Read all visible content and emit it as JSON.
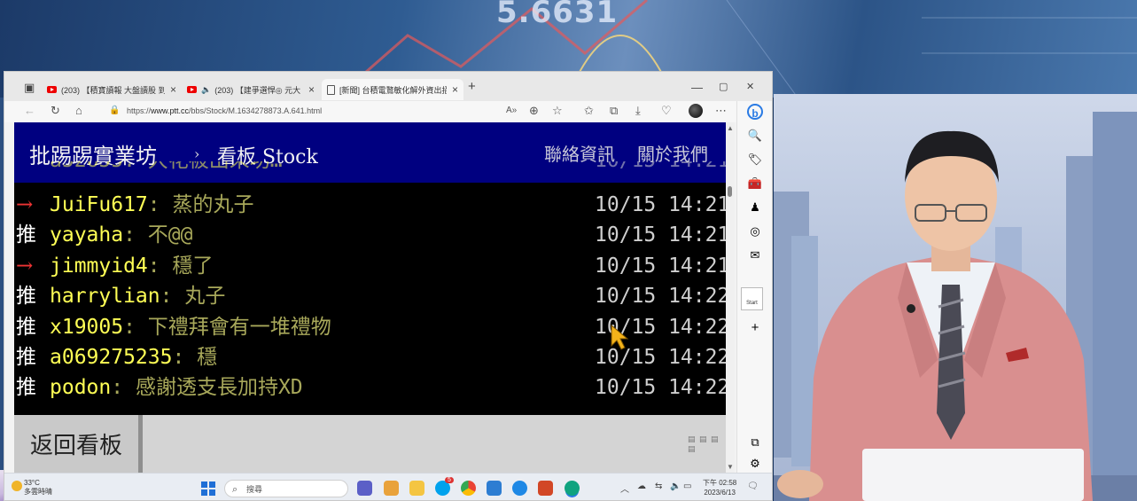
{
  "background": {
    "ticker_text": "5.6631"
  },
  "browser": {
    "tabs": [
      {
        "label": "(203) 【積寶讀報 大盤讀股 到府",
        "icon": "youtube-icon",
        "active": false
      },
      {
        "label": "(203) 【建爭選悍◎ 元大・…",
        "icon": "youtube-icon",
        "active": false
      },
      {
        "label": "[新聞] 台積電鶩敏化解外資出招",
        "icon": "document-icon",
        "active": true
      }
    ],
    "new_tab": "+",
    "window_controls": {
      "minimize": "—",
      "maximize": "▢",
      "close": "✕"
    },
    "url": {
      "scheme": "https://",
      "host": "www.ptt.cc",
      "path": "/bbs/Stock/M.1634278873.A.641.html"
    }
  },
  "ptt": {
    "logo": "批踢踢實業坊",
    "separator": "›",
    "board": "看板 Stock",
    "links": [
      "聯絡資訊",
      "關於我們"
    ],
    "pushes": [
      {
        "tag": "→",
        "type": "arrow",
        "user": "JuiFu617",
        "content": "蒸的丸子",
        "time": "10/15 14:21"
      },
      {
        "tag": "推",
        "type": "push",
        "user": "yayaha",
        "content": "不@@",
        "time": "10/15 14:21"
      },
      {
        "tag": "→",
        "type": "arrow",
        "user": "jimmyid4",
        "content": "穩了",
        "time": "10/15 14:21"
      },
      {
        "tag": "推",
        "type": "push",
        "user": "harrylian",
        "content": "丸子",
        "time": "10/15 14:22"
      },
      {
        "tag": "推",
        "type": "push",
        "user": "x19005",
        "content": "下禮拜會有一堆禮物",
        "time": "10/15 14:22"
      },
      {
        "tag": "推",
        "type": "push",
        "user": "a069275235",
        "content": "穩",
        "time": "10/15 14:22"
      },
      {
        "tag": "推",
        "type": "push",
        "user": "podon",
        "content": "感謝透支長加持XD",
        "time": "10/15 14:22"
      }
    ],
    "back_button": "返回看板"
  },
  "sidebar": {
    "start_label": "Start"
  },
  "taskbar": {
    "weather_temp": "33°C",
    "weather_desc": "多雲時晴",
    "search_placeholder": "搜尋",
    "time": "下午 02:58",
    "date": "2023/6/13",
    "skype_badge": "5"
  },
  "colors": {
    "ptt_header": "#000080",
    "push_user": "#ffff55",
    "push_content": "#a8a85a",
    "arrow_tag": "#e33333",
    "edge_accent": "#2a7be4"
  }
}
